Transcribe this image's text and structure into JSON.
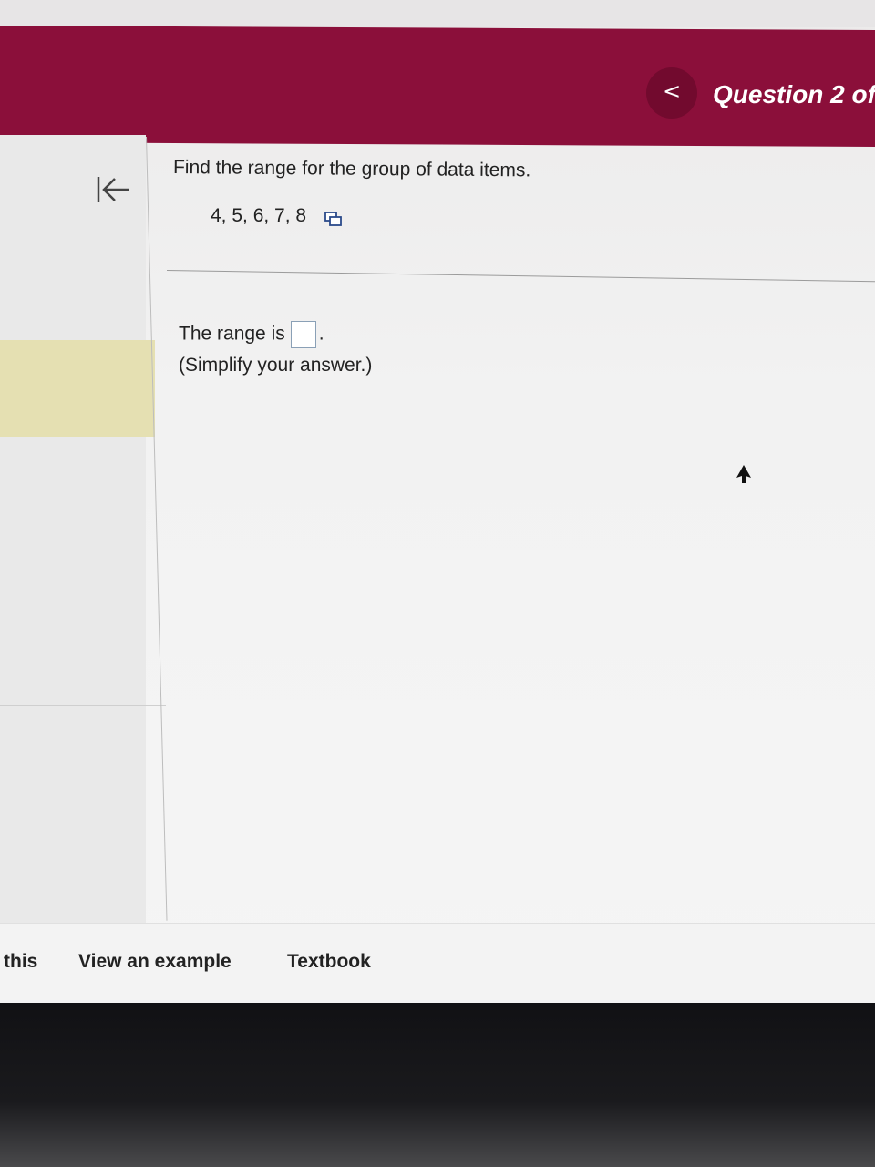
{
  "header": {
    "nav_back_glyph": "<",
    "question_counter": "Question 2 of",
    "background_color": "#8b0f3a"
  },
  "sidebar": {
    "collapse_icon": "collapse-left-icon",
    "highlight_color": "#e5e0b2"
  },
  "question": {
    "prompt": "Find the range for the group of data items.",
    "data_items": "4, 5, 6, 7, 8",
    "copy_icon": "copy-data-icon"
  },
  "answer": {
    "prefix": "The range is",
    "suffix": ".",
    "hint": "(Simplify your answer.)",
    "value": ""
  },
  "footer": {
    "links": [
      "this",
      "View an example",
      "Textbook"
    ]
  }
}
